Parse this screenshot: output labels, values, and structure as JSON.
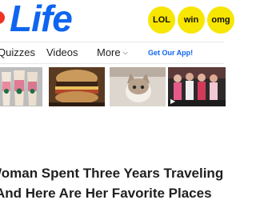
{
  "header": {
    "logo_text": "Life",
    "badges": [
      "LOL",
      "win",
      "omg"
    ]
  },
  "nav": {
    "quizzes": "Quizzes",
    "videos": "Videos",
    "more": "More",
    "app": "Get Our App!"
  },
  "article": {
    "line1": "Woman Spent Three Years Traveling",
    "line2": "And Here Are Her Favorite Places"
  },
  "colors": {
    "brand_blue": "#0f65ef",
    "badge_yellow": "#f7e600",
    "logo_red": "#ee3322"
  }
}
